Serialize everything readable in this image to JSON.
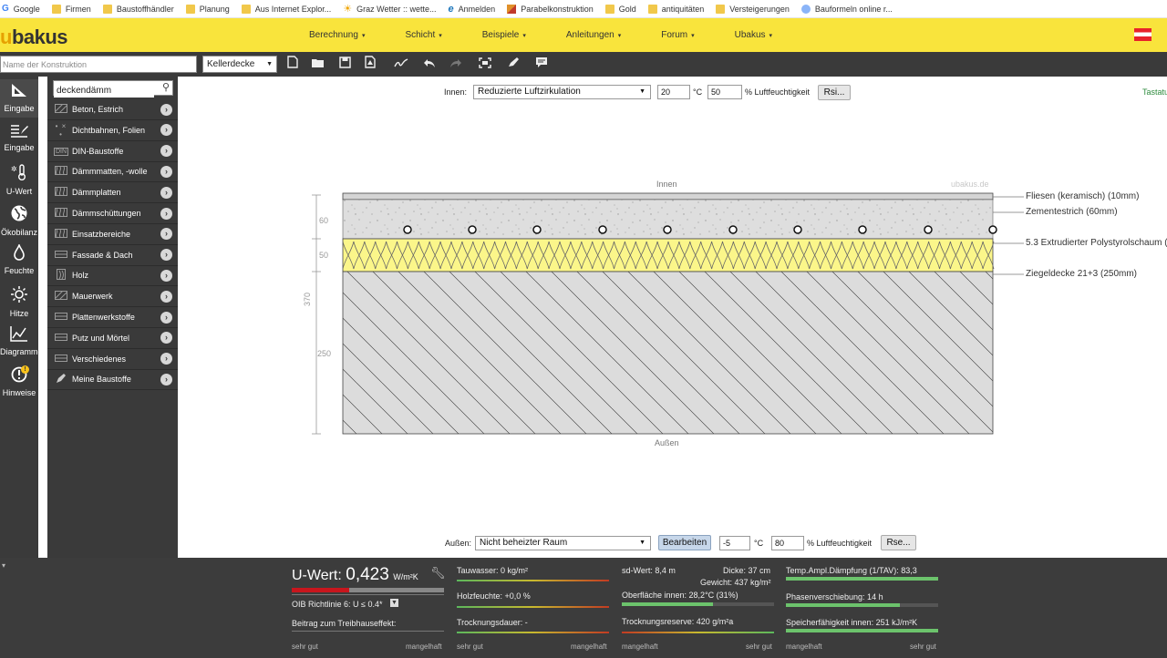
{
  "bookmarks": [
    {
      "label": "Google",
      "icon": "google-icon"
    },
    {
      "label": "Firmen",
      "icon": "folder-icon"
    },
    {
      "label": "Baustoffhändler",
      "icon": "folder-icon"
    },
    {
      "label": "Planung",
      "icon": "folder-icon"
    },
    {
      "label": "Aus Internet Explor...",
      "icon": "folder-icon"
    },
    {
      "label": "Graz Wetter :: wette...",
      "icon": "sun-icon"
    },
    {
      "label": "Anmelden",
      "icon": "ie-icon"
    },
    {
      "label": "Parabelkonstruktion",
      "icon": "parabola-icon"
    },
    {
      "label": "Gold",
      "icon": "folder-icon"
    },
    {
      "label": "antiquitäten",
      "icon": "folder-icon"
    },
    {
      "label": "Versteigerungen",
      "icon": "folder-icon"
    },
    {
      "label": "Bauformeln online r...",
      "icon": "globe-icon"
    }
  ],
  "header": {
    "logo": "ubakus",
    "nav": [
      "Berechnung",
      "Schicht",
      "Beispiele",
      "Anleitungen",
      "Forum",
      "Ubakus"
    ]
  },
  "toolbar": {
    "name_placeholder": "Name der Konstruktion",
    "type_value": "Kellerdecke",
    "tools": [
      "new-file-icon",
      "open-folder-icon",
      "save-icon",
      "pdf-icon",
      "sign-icon",
      "undo-icon",
      "redo-icon",
      "fit-view-icon",
      "edit-icon",
      "comment-icon"
    ]
  },
  "sidebar": {
    "items": [
      {
        "label": "Eingabe",
        "icon": "ruler-icon"
      },
      {
        "label": "Eingabe",
        "icon": "table-edit-icon"
      },
      {
        "label": "U-Wert",
        "icon": "thermometer-icon"
      },
      {
        "label": "Ökobilanz",
        "icon": "globe-icon"
      },
      {
        "label": "Feuchte",
        "icon": "drop-icon"
      },
      {
        "label": "Hitze",
        "icon": "sun-icon"
      },
      {
        "label": "Diagramme",
        "icon": "chart-icon"
      },
      {
        "label": "Hinweise",
        "icon": "warning-icon",
        "badge": "!"
      }
    ]
  },
  "materials": {
    "search_value": "deckendämm",
    "items": [
      {
        "label": "Beton, Estrich",
        "icon": "hatch-icon"
      },
      {
        "label": "Dichtbahnen, Folien",
        "icon": "membrane-icon"
      },
      {
        "label": "DIN-Baustoffe",
        "icon": "din-icon"
      },
      {
        "label": "Dämmmatten, -wolle",
        "icon": "insulation-icon"
      },
      {
        "label": "Dämmplatten",
        "icon": "insulation-icon"
      },
      {
        "label": "Dämmschüttungen",
        "icon": "insulation-icon"
      },
      {
        "label": "Einsatzbereiche",
        "icon": "insulation-icon"
      },
      {
        "label": "Fassade & Dach",
        "icon": "board-icon"
      },
      {
        "label": "Holz",
        "icon": "wood-icon"
      },
      {
        "label": "Mauerwerk",
        "icon": "hatch-icon"
      },
      {
        "label": "Plattenwerkstoffe",
        "icon": "board-icon"
      },
      {
        "label": "Putz und Mörtel",
        "icon": "board-icon"
      },
      {
        "label": "Verschiedenes",
        "icon": "board-icon"
      },
      {
        "label": "Meine Baustoffe",
        "icon": "pencil-icon"
      }
    ]
  },
  "inside": {
    "label": "Innen:",
    "climate": "Reduzierte Luftzirkulation",
    "temp": "20",
    "temp_unit": "°C",
    "humidity": "50",
    "humidity_unit": "% Luftfeuchtigkeit",
    "rsi_button": "Rsi..."
  },
  "outside": {
    "label": "Außen:",
    "climate": "Nicht beheizter Raum",
    "edit_button": "Bearbeiten",
    "temp": "-5",
    "temp_unit": "°C",
    "humidity": "80",
    "humidity_unit": "% Luftfeuchtigkeit",
    "rse_button": "Rse..."
  },
  "keyboard_hint": "Tastatu",
  "drawing": {
    "top_label": "Innen",
    "bottom_label": "Außen",
    "watermark": "ubakus.de",
    "dims": [
      "60",
      "50",
      "250"
    ],
    "total": "370",
    "layers": [
      "Fliesen (keramisch) (10mm)",
      "Zementestrich (60mm)",
      "5.3 Extrudierter Polystyrolschaum (",
      "Ziegeldecke 21+3 (250mm)"
    ]
  },
  "results": {
    "uwert_label": "U-Wert:",
    "uwert_value": "0,423",
    "uwert_unit": "W/m²K",
    "uwert_rating": 0.38,
    "oib": "OIB Richtlinie 6: U ≤ 0.4*",
    "greenhouse": "Beitrag zum Treibhauseffekt:",
    "scale1_left": "sehr gut",
    "scale1_right": "mangelhaft",
    "tauwasser": "Tauwasser: 0 kg/m²",
    "holzfeuchte": "Holzfeuchte: +0,0 %",
    "trocknungsdauer": "Trocknungsdauer: -",
    "scale2_left": "sehr gut",
    "scale2_right": "mangelhaft",
    "sdwert": "sd-Wert: 8,4 m",
    "dicke": "Dicke: 37 cm",
    "gewicht": "Gewicht: 437 kg/m²",
    "oberflaeche": "Oberfläche innen: 28,2°C (31%)",
    "oberflaeche_rating": 0.6,
    "trocknungsreserve": "Trocknungsreserve: 420 g/m²a",
    "scale3_left": "mangelhaft",
    "scale3_right": "sehr gut",
    "tempamp": "Temp.Ampl.Dämpfung (1/TAV): 83,3",
    "tempamp_rating": 1.0,
    "phasen": "Phasenverschiebung: 14 h",
    "phasen_rating": 0.75,
    "speicher": "Speicherfähigkeit innen: 251 kJ/m²K",
    "speicher_rating": 1.0,
    "scale4_left": "mangelhaft",
    "scale4_right": "sehr gut"
  }
}
